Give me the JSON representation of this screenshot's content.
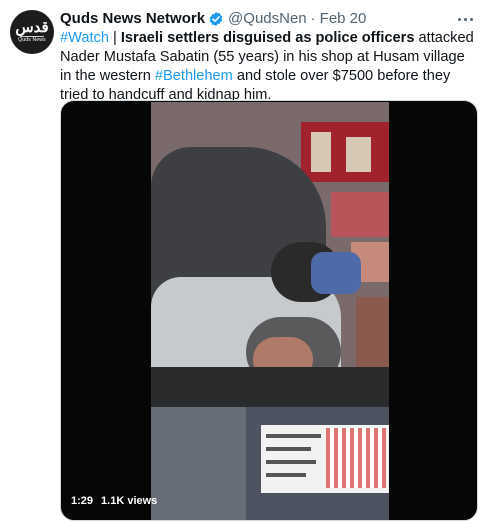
{
  "account": {
    "avatar_logo_text": "قدس",
    "avatar_logo_sub": "Quds News",
    "name": "Quds News Network",
    "handle": "@QudsNen",
    "separator": "·",
    "date": "Feb 20",
    "verified_icon": "verified-badge-icon",
    "brand_color": "#1d9bf0"
  },
  "tweet": {
    "hashtag_watch": "#Watch",
    "pipe": " | ",
    "bold_text": "Israeli settlers disguised as police officers",
    "text_part1": " attacked Nader Mustafa Sabatin (55 years) in his shop at Husam village in the western ",
    "hashtag_place": "#Bethlehem",
    "text_part2": " and stole over $7500 before they tried to handcuff and kidnap him."
  },
  "video": {
    "duration": "1:29",
    "views": "1.1K views"
  }
}
